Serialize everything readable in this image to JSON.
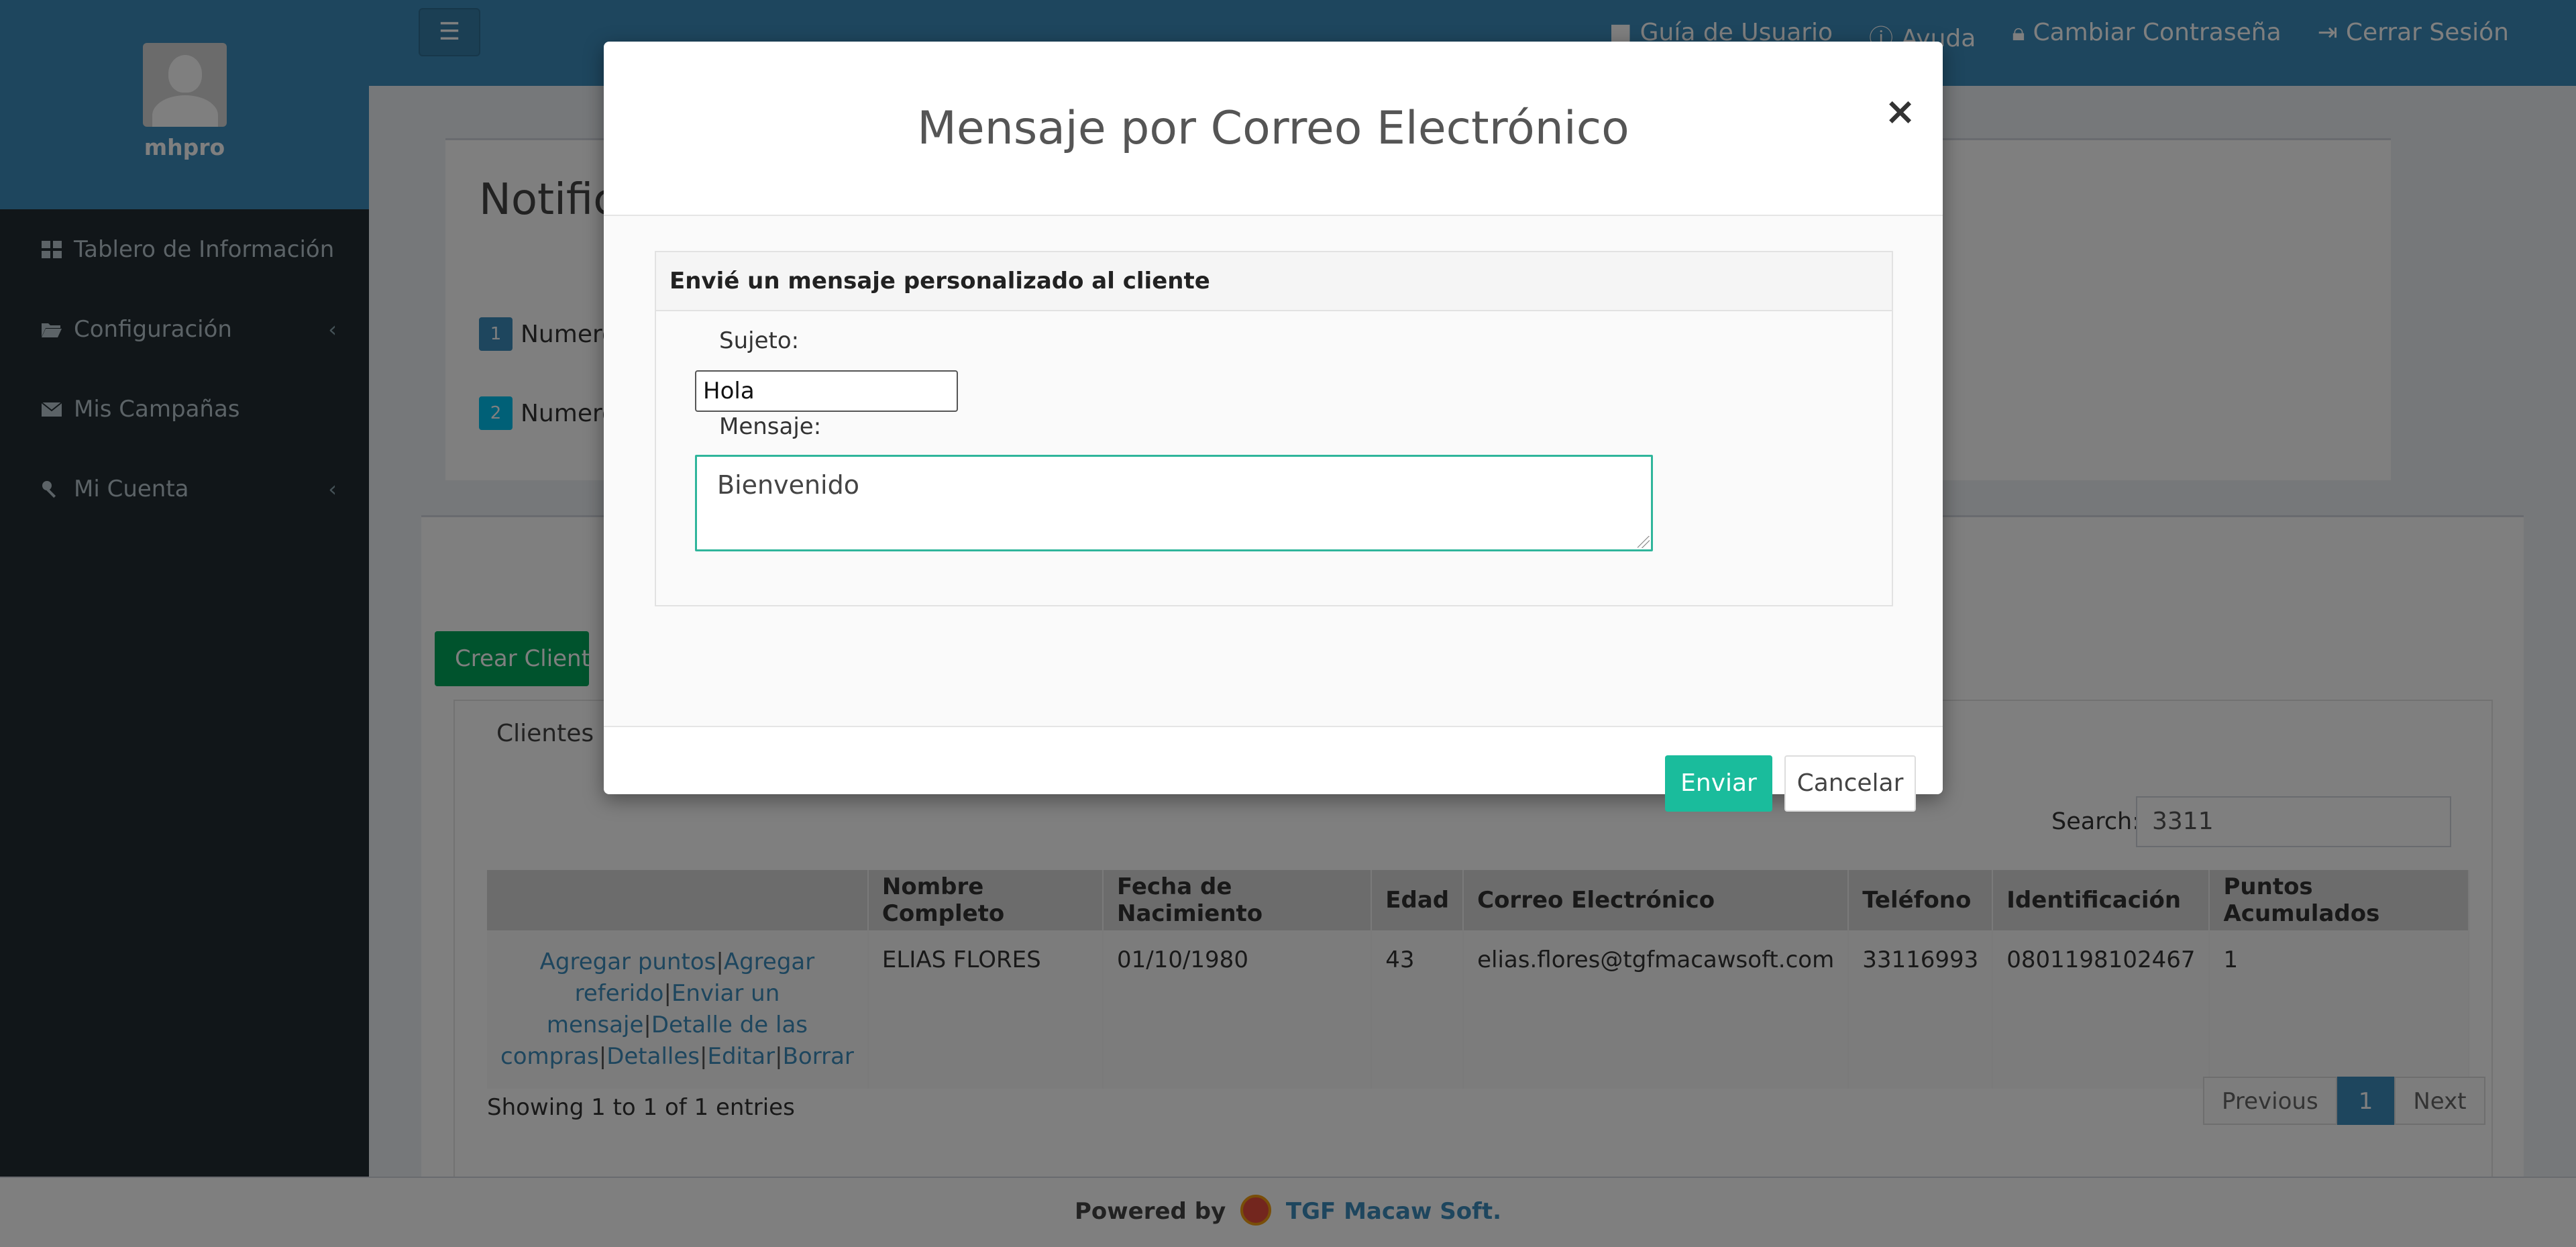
{
  "sidebar": {
    "username": "mhpro",
    "items": [
      {
        "label": "Tablero de Información",
        "icon": "dashboard-icon",
        "has_submenu": false
      },
      {
        "label": "Configuración",
        "icon": "folder-open-icon",
        "has_submenu": true
      },
      {
        "label": "Mis Campañas",
        "icon": "envelope-icon",
        "has_submenu": false
      },
      {
        "label": "Mi Cuenta",
        "icon": "key-icon",
        "has_submenu": true
      }
    ]
  },
  "topbar": {
    "links": [
      {
        "label": "Guía de Usuario",
        "icon": "video-camera-icon"
      },
      {
        "label": "Ayuda",
        "icon": "info-circle-icon"
      },
      {
        "label": "Cambiar Contraseña",
        "icon": "lock-icon"
      },
      {
        "label": "Cerrar Sesión",
        "icon": "sign-out-icon"
      }
    ]
  },
  "notifications": {
    "title": "Notifica",
    "rows": [
      {
        "badge": "1",
        "text": "Numero"
      },
      {
        "badge": "2",
        "text": "Numero"
      }
    ]
  },
  "clients": {
    "create_button": "Crear Cliente",
    "tab_label": "Clientes",
    "search_label": "Search:",
    "search_value": "3311",
    "columns": [
      "",
      "Nombre Completo",
      "Fecha de Nacimiento",
      "Edad",
      "Correo Electrónico",
      "Teléfono",
      "Identificación",
      "Puntos Acumulados"
    ],
    "row": {
      "actions": [
        "Agregar puntos",
        "Agregar referido",
        "Enviar un mensaje",
        "Detalle de las compras",
        "Detalles",
        "Editar",
        "Borrar"
      ],
      "nombre": "ELIAS FLORES",
      "fecha": "01/10/1980",
      "edad": "43",
      "correo": "elias.flores@tgfmacawsoft.com",
      "telefono": "33116993",
      "identificacion": "0801198102467",
      "puntos": "1"
    },
    "showing": "Showing 1 to 1 of 1 entries",
    "pager": {
      "previous": "Previous",
      "page": "1",
      "next": "Next"
    }
  },
  "footer": {
    "powered": "Powered by",
    "brand": "TGF Macaw Soft."
  },
  "modal": {
    "title": "Mensaje por Correo Electrónico",
    "close": "×",
    "panel_heading": "Envié un mensaje personalizado al cliente",
    "subject_label": "Sujeto:",
    "subject_value": "Hola",
    "message_label": "Mensaje:",
    "message_value": "Bienvenido",
    "send_button": "Enviar",
    "cancel_button": "Cancelar"
  },
  "colors": {
    "primary": "#3c8dbc",
    "sidebar": "#222d32",
    "success": "#00a65a",
    "teal": "#1abc9c"
  }
}
